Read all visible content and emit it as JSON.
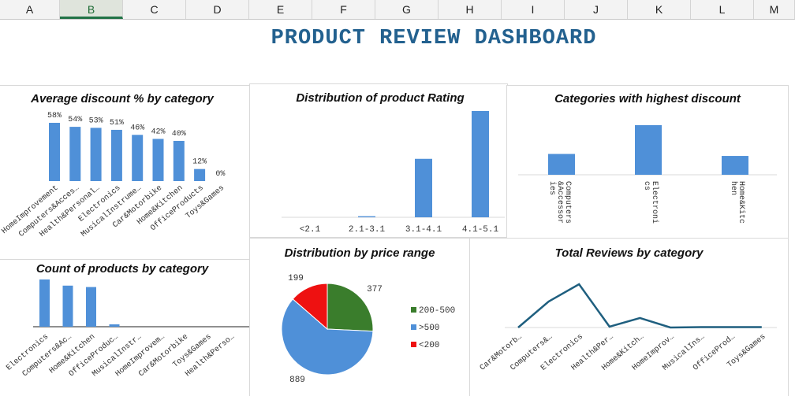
{
  "spreadsheet": {
    "columns": [
      "A",
      "B",
      "C",
      "D",
      "E",
      "F",
      "G",
      "H",
      "I",
      "J",
      "K",
      "L",
      "M"
    ],
    "selected_column": "B"
  },
  "dashboard": {
    "title": "PRODUCT REVIEW DASHBOARD"
  },
  "colors": {
    "bar": "#4f90d8",
    "line": "#1f5f7f",
    "green": "#3a7d2c",
    "blue": "#4f90d8",
    "red": "#ee1111",
    "title": "#23618f"
  },
  "chart_data": [
    {
      "id": "avg_discount",
      "type": "bar",
      "title": "Average discount % by category",
      "categories": [
        "HomeImprovement",
        "Computers&Acces…",
        "Health&Personal…",
        "Electronics",
        "MusicalInstrume…",
        "Car&Motorbike",
        "Home&Kitchen",
        "OfficeProducts",
        "Toys&Games"
      ],
      "values": [
        58,
        54,
        53,
        51,
        46,
        42,
        40,
        12,
        0
      ],
      "data_labels": [
        "58%",
        "54%",
        "53%",
        "51%",
        "46%",
        "42%",
        "40%",
        "12%",
        "0%"
      ]
    },
    {
      "id": "rating_dist",
      "type": "bar",
      "title": "Distribution of product Rating",
      "categories": [
        "<2.1",
        "2.1-3.1",
        "3.1-4.1",
        "4.1-5.1"
      ],
      "values": [
        0,
        1,
        55,
        100
      ]
    },
    {
      "id": "top_discount",
      "type": "bar",
      "title": "Categories with highest discount",
      "categories": [
        "Computers&Accessories",
        "Electronics",
        "Home&Kitchen"
      ],
      "category_label_lines": [
        [
          "Computers",
          "&Accessor",
          "ies"
        ],
        [
          "Electroni",
          "cs"
        ],
        [
          "Home&Kitc",
          "hen"
        ]
      ],
      "values": [
        42,
        100,
        38
      ]
    },
    {
      "id": "count_products",
      "type": "bar",
      "title": "Count of products by category",
      "categories": [
        "Electronics",
        "Computers&Ac…",
        "Home&Kitchen",
        "OfficeProduc…",
        "MusicalInstr…",
        "HomeImprovem…",
        "Car&Motorbike",
        "Toys&Games",
        "Health&Perso…"
      ],
      "values": [
        100,
        87,
        84,
        5,
        0,
        0,
        0,
        0,
        0
      ]
    },
    {
      "id": "price_range",
      "type": "pie",
      "title": "Distribution by price range",
      "slices": [
        {
          "name": "200-500",
          "value": 377,
          "color": "#3a7d2c"
        },
        {
          "name": ">500",
          "value": 889,
          "color": "#4f90d8"
        },
        {
          "name": "<200",
          "value": 199,
          "color": "#ee1111"
        }
      ],
      "legend": "right"
    },
    {
      "id": "total_reviews",
      "type": "line",
      "title": "Total Reviews by category",
      "categories": [
        "Car&Motorb…",
        "Computers&…",
        "Electronics",
        "Health&Per…",
        "Home&Kitch…",
        "HomeImprov…",
        "MusicalIns…",
        "OfficeProd…",
        "Toys&Games"
      ],
      "values": [
        0,
        60,
        100,
        2,
        22,
        0,
        1,
        1,
        1
      ]
    }
  ]
}
